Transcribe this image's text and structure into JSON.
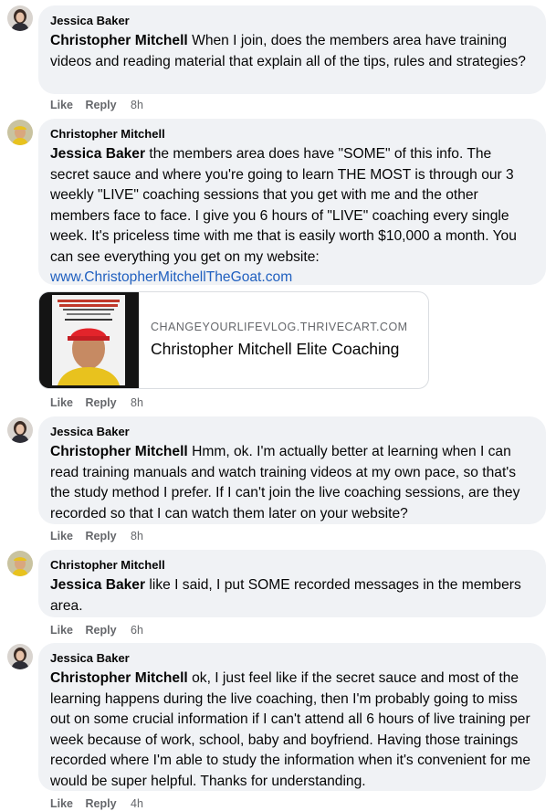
{
  "comments": [
    {
      "author": "Jessica Baker",
      "mention": "Christopher Mitchell",
      "text": " When I join, does the members area have training videos and reading material that explain all of the tips, rules and strategies?",
      "actions": {
        "like": "Like",
        "reply": "Reply",
        "time": "8h"
      }
    },
    {
      "author": "Christopher Mitchell",
      "mention": "Jessica Baker",
      "text": " the members area does have \"SOME\" of this info. The secret sauce and where you're going to learn THE MOST is through our 3 weekly \"LIVE\" coaching sessions that you get with me and the other members face to face. I give you 6 hours of \"LIVE\" coaching every single week. It's priceless time with me that is easily worth $10,000 a month. You can see everything you get on my website: ",
      "link": "www.ChristopherMitchellTheGoat.com",
      "preview": {
        "domain": "CHANGEYOURLIFEVLOG.THRIVECART.COM",
        "title": "Christopher Mitchell Elite Coaching"
      },
      "actions": {
        "like": "Like",
        "reply": "Reply",
        "time": "8h"
      }
    },
    {
      "author": "Jessica Baker",
      "mention": "Christopher Mitchell",
      "text": " Hmm, ok. I'm actually better at learning when I can read training manuals and watch training videos at my own pace, so that's the study method I prefer. If I can't join the live coaching sessions, are they recorded so that I can watch them later on your website?",
      "actions": {
        "like": "Like",
        "reply": "Reply",
        "time": "8h"
      }
    },
    {
      "author": "Christopher Mitchell",
      "mention": "Jessica Baker",
      "text": " like I said, I put SOME recorded messages in the members area.",
      "actions": {
        "like": "Like",
        "reply": "Reply",
        "time": "6h"
      }
    },
    {
      "author": "Jessica Baker",
      "mention": "Christopher Mitchell",
      "text": " ok, I just feel like if the secret sauce and most of the learning happens during the live coaching, then I'm probably going to miss out on some crucial information if I can't attend all 6 hours of live training per week because of work, school, baby and boyfriend. Having those trainings recorded where I'm able to study the information when it's convenient for me would be super helpful. Thanks for understanding.",
      "actions": {
        "like": "Like",
        "reply": "Reply",
        "time": "4h"
      }
    }
  ],
  "colors": {
    "bubble": "#f0f2f5",
    "link": "#1f5fbf",
    "secondary_text": "#65676b"
  }
}
